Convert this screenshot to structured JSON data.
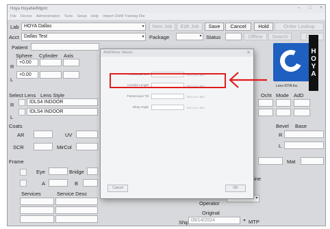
{
  "window": {
    "title": "Hoya HoyaNetMgmt",
    "menu": [
      "File",
      "Device",
      "Administration",
      "Tools",
      "Setup",
      "Help",
      "Import OHM Training File"
    ],
    "controls": [
      "–",
      "□",
      "×"
    ]
  },
  "order": {
    "lab_label": "Lab",
    "lab_value": "HOYA Dallas",
    "acct_label": "Acct",
    "acct_value": "Dallas Test",
    "toolbar": {
      "new_job": "New Job",
      "edit_job": "Edit Job",
      "save": "Save",
      "cancel": "Cancel",
      "hold": "Hold",
      "order_lookup": "Order Lookup",
      "offline": "Offline",
      "search": "Search",
      "close": "Close"
    },
    "patient_label": "Patient",
    "package_label": "Package",
    "status_label": "Status",
    "rx": {
      "headers": [
        "Sphere",
        "Cylinder",
        "Axis"
      ],
      "rows": [
        {
          "eye": "R",
          "sphere": "+0.00"
        },
        {
          "eye": "L",
          "sphere": "+0.00"
        }
      ]
    },
    "lens": {
      "headers": [
        "Select Lens",
        "Lens Style"
      ],
      "rows": [
        {
          "eye": "R",
          "style": "IDLS4 INDOOR"
        },
        {
          "eye": "L",
          "style": "IDLS4 INDOOR"
        }
      ],
      "right_headers": [
        "Ocht",
        "Mode",
        "AdD"
      ]
    },
    "coats": {
      "label": "Coats",
      "ar": "AR",
      "uv": "UV",
      "scr": "SCR",
      "mirror": "MirCol"
    },
    "bevel": {
      "label": "Bevel",
      "base": "Base",
      "r": "R",
      "l": "L"
    },
    "frame": {
      "label": "Frame",
      "eye": "Eye",
      "bridge": "Bridge",
      "a": "A",
      "b": "B",
      "mat": "Mat",
      "services": "Services",
      "service_desc": "Service Desc",
      "line": "Line"
    },
    "operator_label": "Operator",
    "original_label": "Original",
    "original_value": "09/14/2024",
    "ship_label": "Ship",
    "ship_value": "MTP"
  },
  "logo": {
    "letters": [
      "H",
      "O",
      "Y",
      "A"
    ],
    "subtext": "Lens IOTA Inc."
  },
  "dialog": {
    "title": "Add/Store Values",
    "rows": [
      {
        "label": "Horizontal Mm",
        "note": "000.1 to 1.500"
      },
      {
        "label": "Corridor Length",
        "note": "000.1 to 1.500"
      },
      {
        "label": "Pantoscopic Tilt",
        "note": "000.1 to 1.500"
      },
      {
        "label": "Wrap Angle",
        "note": "000.1 to 1.500"
      }
    ],
    "cancel_label": "Cancel",
    "ok_label": "OK"
  },
  "annotation": {
    "highlight_color": "#e01b1b"
  }
}
